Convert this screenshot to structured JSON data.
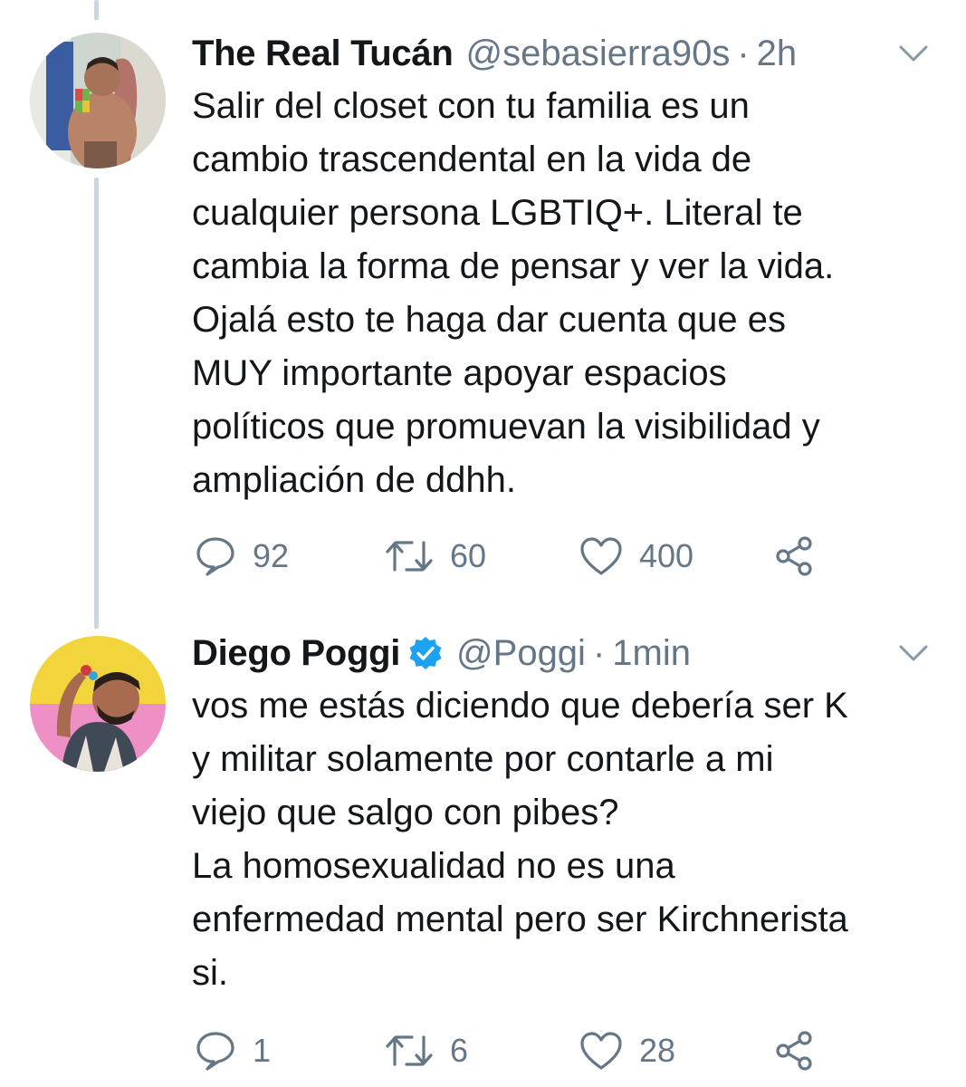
{
  "tweets": [
    {
      "display_name": "The Real Tucán",
      "handle": "@sebasierra90s",
      "separator": "·",
      "time": "2h",
      "verified": false,
      "text_lines": [
        "Salir del closet con tu familia es un",
        "cambio trascendental en la vida de",
        "cualquier persona LGBTIQ+. Literal te",
        "cambia la forma de pensar y ver la vida.",
        "Ojalá esto te haga dar cuenta que es",
        "MUY importante apoyar espacios",
        "políticos que promuevan la visibilidad y",
        "ampliación de ddhh."
      ],
      "replies": "92",
      "retweets": "60",
      "likes": "400"
    },
    {
      "display_name": "Diego Poggi",
      "handle": "@Poggi",
      "separator": "·",
      "time": "1min",
      "verified": true,
      "text_lines": [
        "vos me estás diciendo que debería ser K",
        "y militar solamente por contarle a mi",
        "viejo que salgo con pibes?",
        "La homosexualidad no es una",
        "enfermedad mental pero ser Kirchnerista",
        "si."
      ],
      "replies": "1",
      "retweets": "6",
      "likes": "28"
    }
  ],
  "colors": {
    "text_primary": "#14171a",
    "text_secondary": "#657786",
    "thread_line": "#ccd6dd",
    "verified_blue": "#1da1f2"
  },
  "icons": {
    "reply": "reply-icon",
    "retweet": "retweet-icon",
    "like": "heart-icon",
    "share": "share-icon",
    "menu": "chevron-down-icon",
    "verified": "verified-badge-icon"
  }
}
